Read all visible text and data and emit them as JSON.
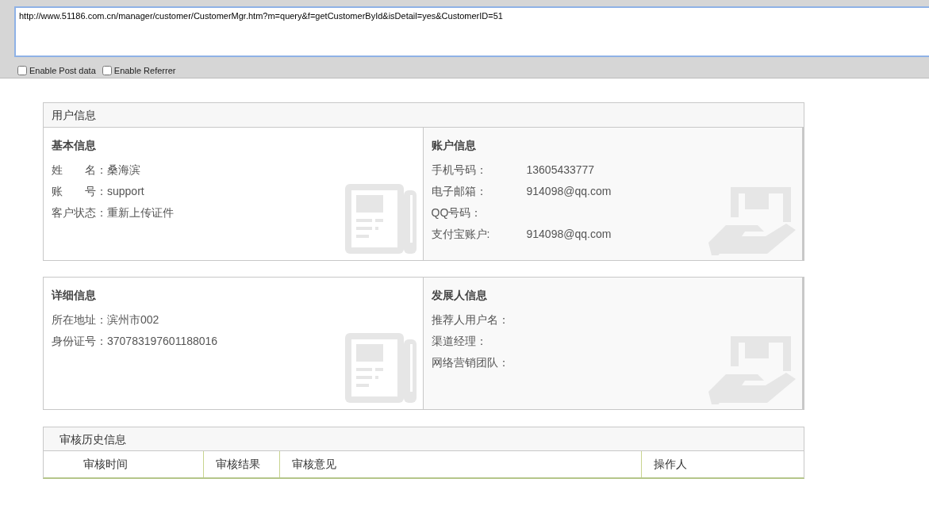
{
  "address_bar": {
    "value": "http://www.51186.com.cn/manager/customer/CustomerMgr.htm?m=query&f=getCustomerById&isDetail=yes&CustomerID=51",
    "options": [
      {
        "label": "Enable Post data",
        "checked": false
      },
      {
        "label": "Enable Referrer",
        "checked": false
      }
    ]
  },
  "panels": [
    {
      "title": "用户信息",
      "sections": [
        {
          "title": "基本信息",
          "kind": "inline",
          "fields": [
            {
              "label": "姓　　名：",
              "value": "桑海滨"
            },
            {
              "label": "账　　号：",
              "value": "support"
            },
            {
              "label": "客户状态：",
              "value": "重新上传证件"
            }
          ]
        },
        {
          "title": "账户信息",
          "kind": "column",
          "fields": [
            {
              "label": "手机号码：",
              "value": "13605433777"
            },
            {
              "label": "电子邮箱：",
              "value": "914098@qq.com"
            },
            {
              "label": "QQ号码："
            },
            {
              "label": "支付宝账户:",
              "value": "914098@qq.com"
            }
          ]
        }
      ]
    },
    {
      "sections": [
        {
          "title": "详细信息",
          "kind": "inline",
          "fields": [
            {
              "label": "所在地址：",
              "value": "滨州市002"
            },
            {
              "label": "身份证号：",
              "value": "370783197601188016"
            }
          ]
        },
        {
          "title": "发展人信息",
          "kind": "inline",
          "fields": [
            {
              "label": "推荐人用户名："
            },
            {
              "label": "渠道经理："
            },
            {
              "label": "网络营销团队："
            }
          ]
        }
      ]
    }
  ],
  "history": {
    "title": "审核历史信息",
    "columns": [
      "审核时间",
      "审核结果",
      "审核意见",
      "操作人"
    ]
  }
}
